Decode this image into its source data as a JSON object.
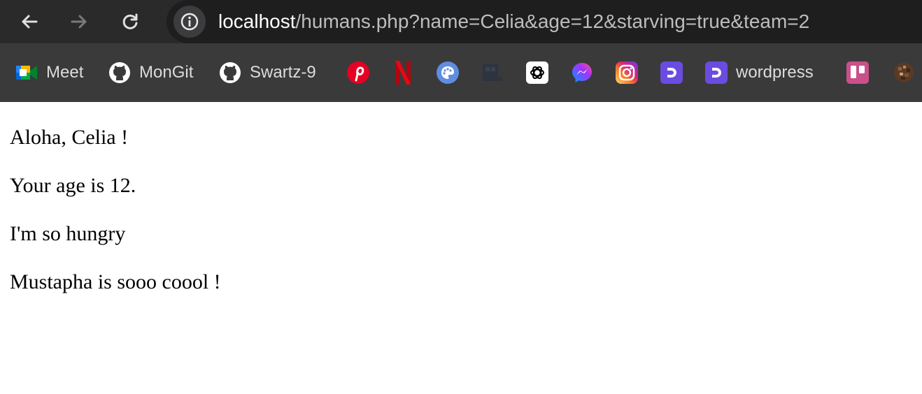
{
  "address_bar": {
    "url_host": "localhost",
    "url_rest": "/humans.php?name=Celia&age=12&starving=true&team=2"
  },
  "bookmarks": [
    {
      "label": "Meet",
      "icon": "google-meet-icon"
    },
    {
      "label": "MonGit",
      "icon": "github-icon"
    },
    {
      "label": "Swartz-9",
      "icon": "github-icon"
    },
    {
      "label": "",
      "icon": "pinterest-icon"
    },
    {
      "label": "",
      "icon": "netflix-icon"
    },
    {
      "label": "",
      "icon": "palette-icon"
    },
    {
      "label": "",
      "icon": "dark-square-icon"
    },
    {
      "label": "",
      "icon": "openai-icon"
    },
    {
      "label": "",
      "icon": "messenger-icon"
    },
    {
      "label": "",
      "icon": "instagram-icon"
    },
    {
      "label": "",
      "icon": "purple-d-icon"
    },
    {
      "label": "wordpress",
      "icon": "purple-d-icon"
    },
    {
      "label": "",
      "icon": "trello-icon"
    },
    {
      "label": "",
      "icon": "pixel-avatar-icon"
    }
  ],
  "page": {
    "line1": "Aloha, Celia !",
    "line2": "Your age is 12.",
    "line3": "I'm so hungry",
    "line4": "Mustapha is sooo coool !"
  },
  "colors": {
    "toolbar_bg": "#2a2a2b",
    "bookmarks_bg": "#3a3a3b",
    "page_bg": "#ffffff"
  }
}
